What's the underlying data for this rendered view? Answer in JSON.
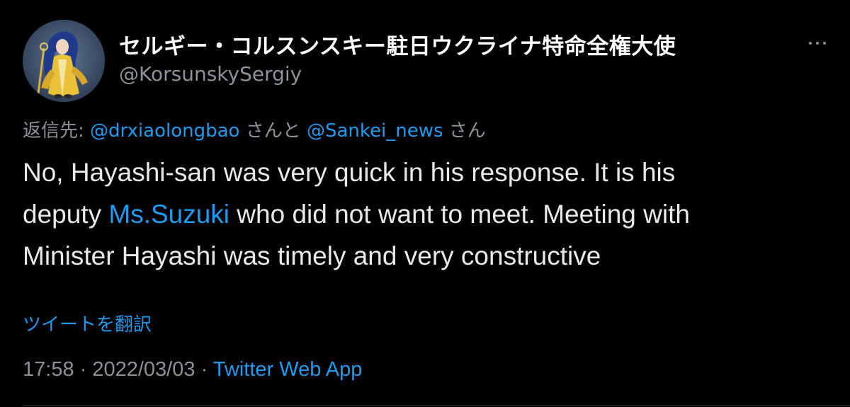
{
  "author": {
    "display_name": "セルギー・コルスンスキー駐日ウクライナ特命全権大使",
    "handle": "@KorsunskySergiy"
  },
  "reply": {
    "prefix": "返信先: ",
    "mention_1": "@drxiaolongbao",
    "join": " さんと ",
    "mention_2": "@Sankei_news",
    "suffix": " さん"
  },
  "tweet": {
    "line_1": "No, Hayashi-san was very quick in his response. It is his",
    "line_2_before": "deputy ",
    "line_2_link": "Ms.Suzuki",
    "line_2_after": " who did not want to meet. Meeting with",
    "line_3": "Minister Hayashi was timely and very constructive"
  },
  "translate_label": "ツイートを翻訳",
  "meta": {
    "time": "17:58",
    "separator": " · ",
    "date": "2022/03/03",
    "source": "Twitter Web App"
  },
  "icons": {
    "more": "more-horizontal-icon"
  },
  "colors": {
    "background": "#000000",
    "text": "#e7e9ea",
    "secondary": "#8b9299",
    "link": "#1d9bf0",
    "divider": "#2f3336"
  }
}
